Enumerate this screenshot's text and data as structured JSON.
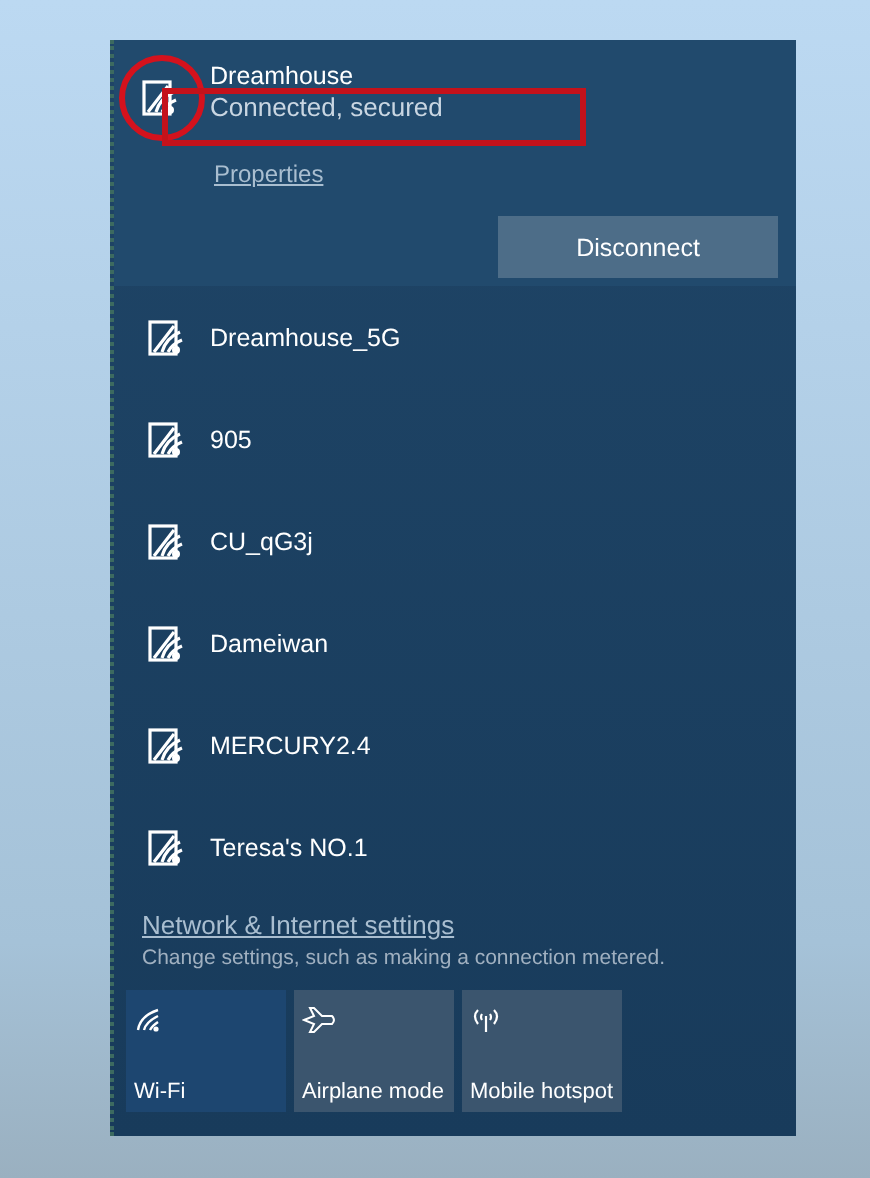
{
  "connected_network": {
    "name": "Dreamhouse",
    "status": "Connected, secured",
    "properties_link": "Properties",
    "disconnect_button": "Disconnect",
    "expanded": true
  },
  "networks": [
    {
      "name": "Dreamhouse_5G"
    },
    {
      "name": "905"
    },
    {
      "name": "CU_qG3j"
    },
    {
      "name": "Dameiwan"
    },
    {
      "name": "MERCURY2.4"
    },
    {
      "name": "Teresa's NO.1"
    }
  ],
  "settings_link": "Network & Internet settings",
  "settings_description": "Change settings, such as making a connection metered.",
  "quick_actions": [
    {
      "kind": "wifi",
      "label": "Wi-Fi",
      "on": true
    },
    {
      "kind": "airplane",
      "label": "Airplane mode",
      "on": false
    },
    {
      "kind": "hotspot",
      "label": "Mobile hotspot",
      "on": false
    }
  ],
  "annotations": [
    {
      "kind": "circle"
    },
    {
      "kind": "rectangle"
    }
  ]
}
